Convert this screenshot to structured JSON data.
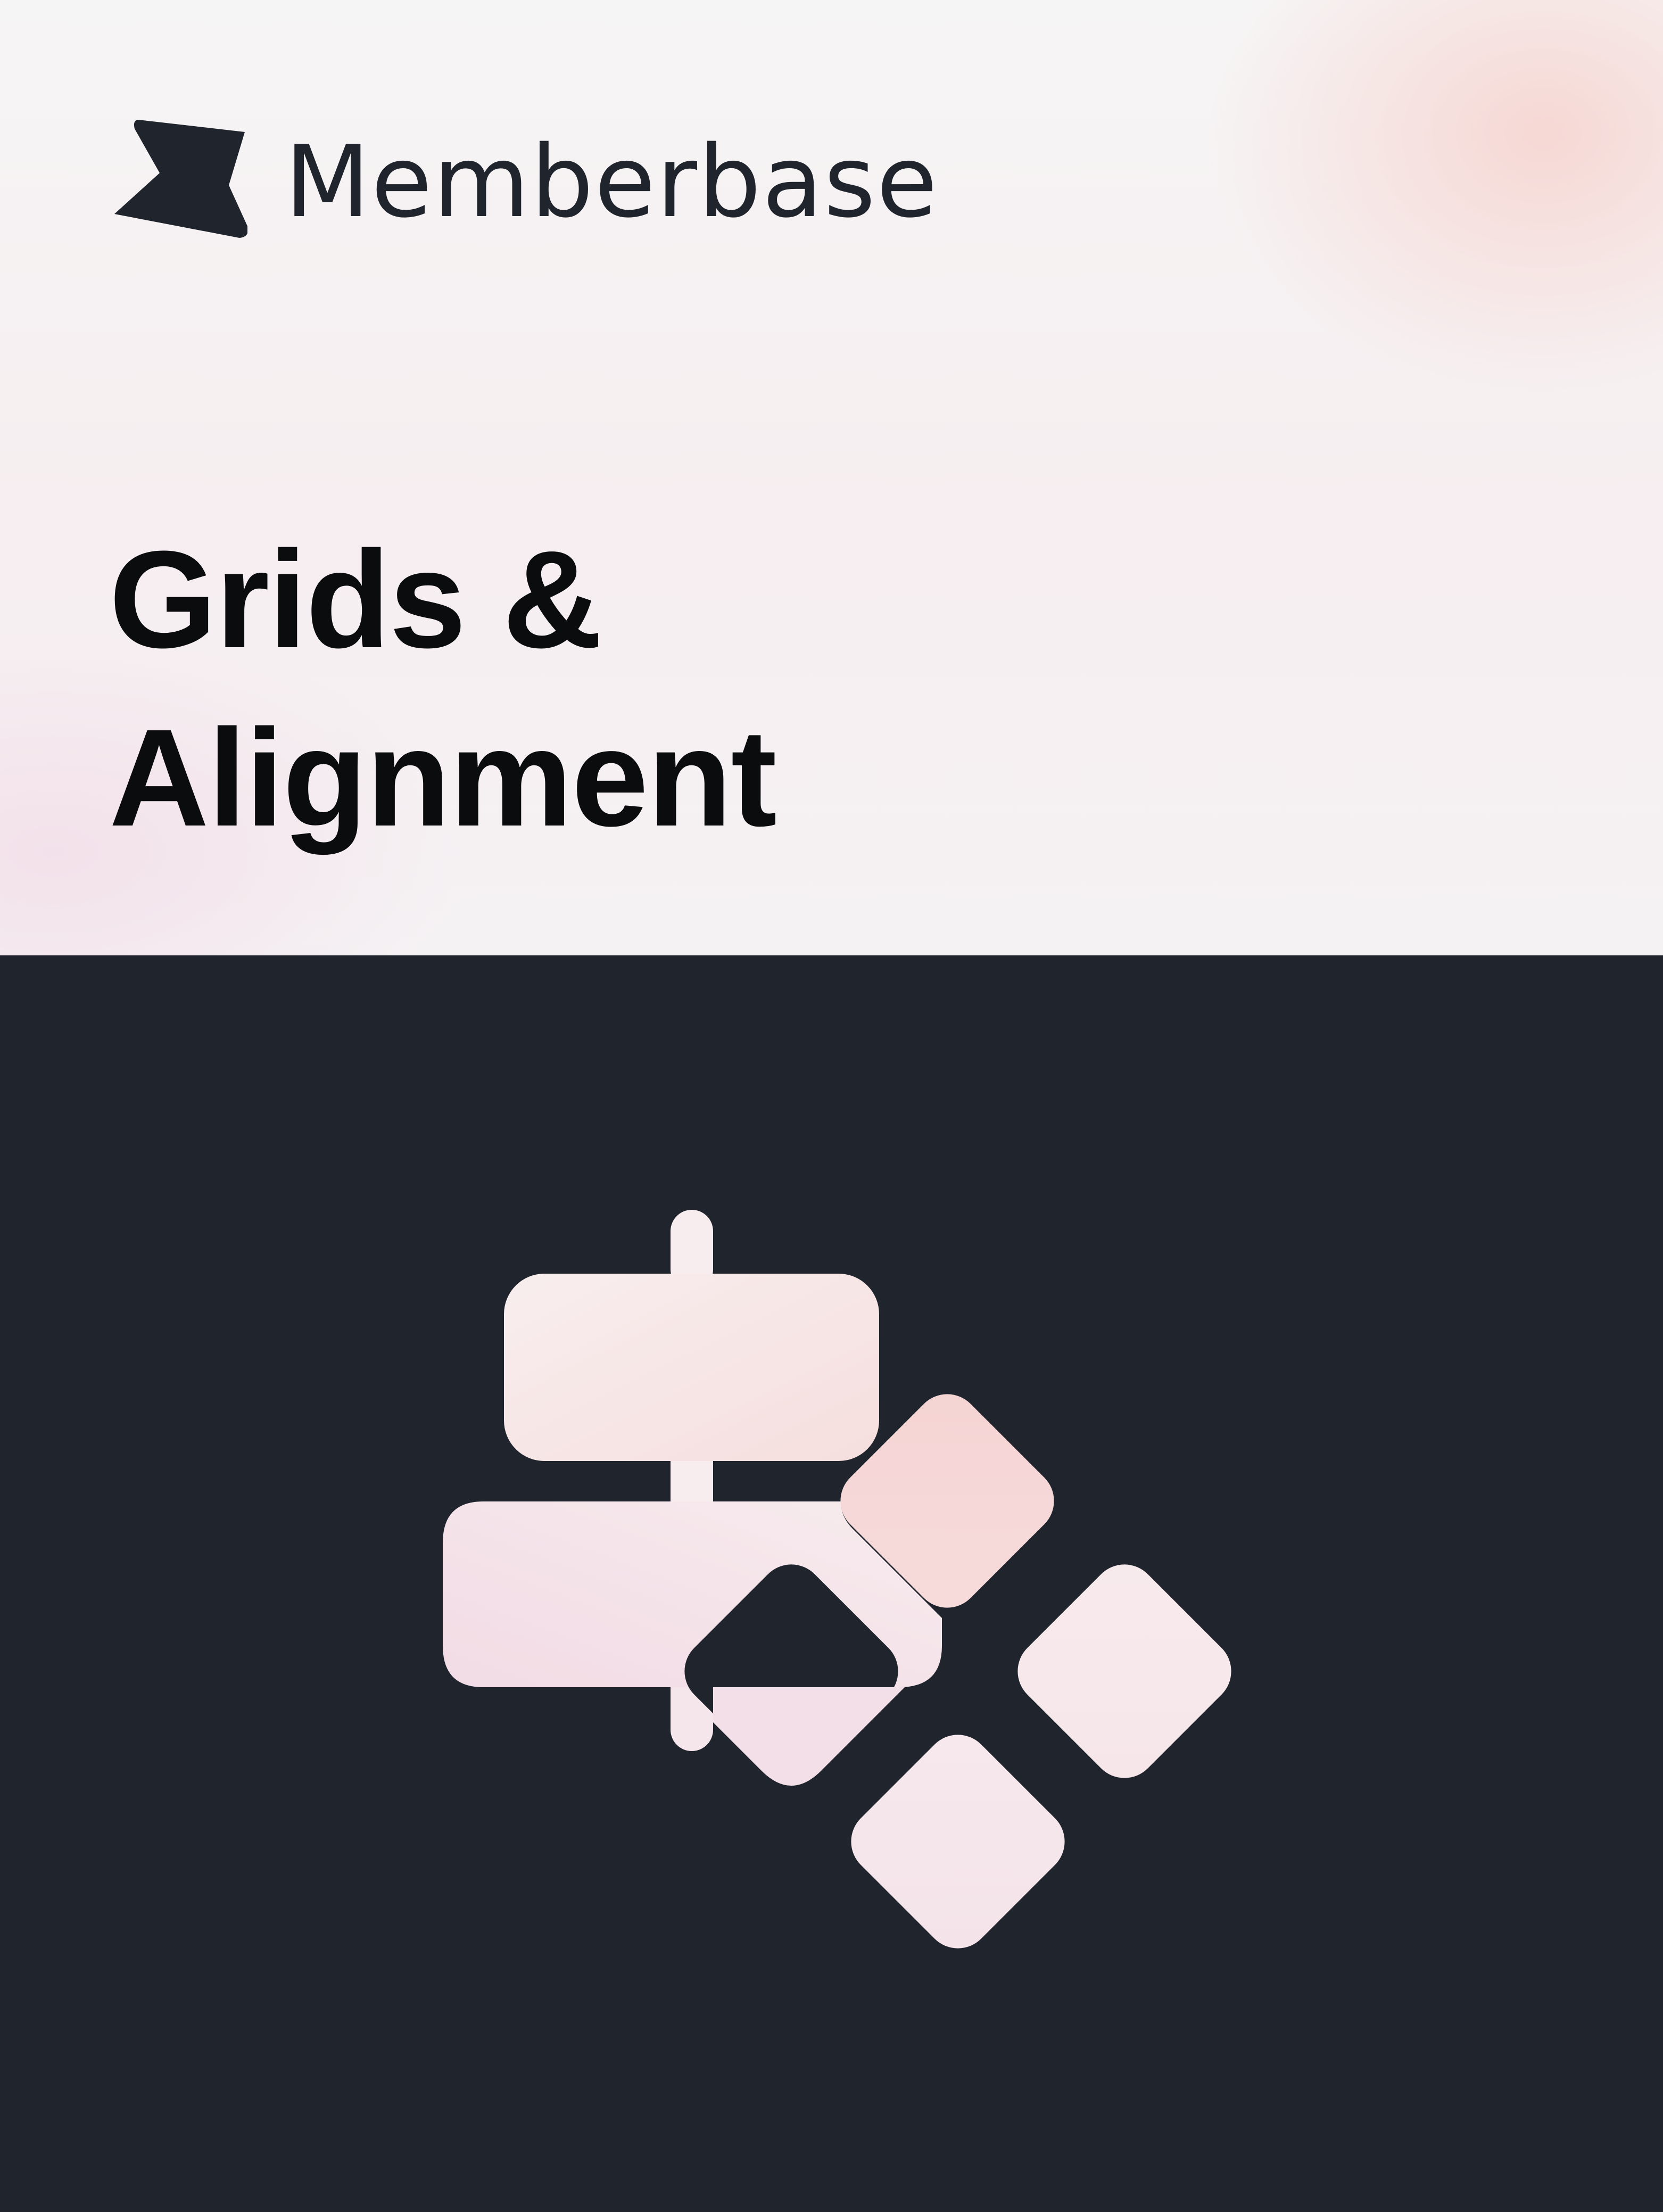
{
  "brand": {
    "name": "Memberbase",
    "logo_icon": "memberbase-flag-logo"
  },
  "headline": {
    "line1": "Grids &",
    "line2": "Alignment"
  },
  "illustration": {
    "icon": "grid-alignment-icon",
    "colors": {
      "light": "#f7ecee",
      "peach": "#f5d6d6",
      "pink": "#f1dbe4",
      "background": "#20242c"
    }
  },
  "colors": {
    "ink": "#20252d",
    "title": "#0b0c0e",
    "dark_panel": "#20242c"
  }
}
